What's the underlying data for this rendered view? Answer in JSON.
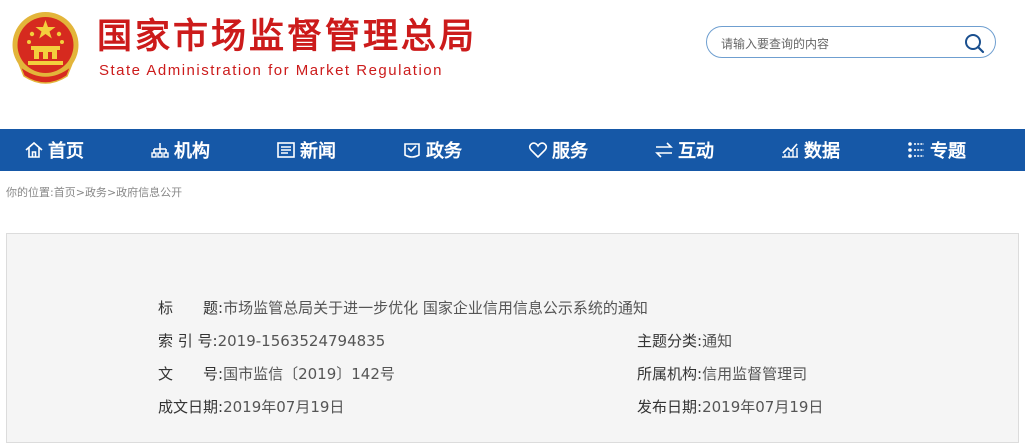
{
  "header": {
    "title_cn": "国家市场监督管理总局",
    "title_en": "State Administration for Market Regulation",
    "emblem_icon": "national-emblem-icon",
    "brand_color": "#cc1b1b"
  },
  "search": {
    "placeholder": "请输入要查询的内容",
    "icon": "search-icon"
  },
  "nav": {
    "bg_color": "#1658a7",
    "items": [
      {
        "label": "首页",
        "icon": "home-icon"
      },
      {
        "label": "机构",
        "icon": "org-chart-icon"
      },
      {
        "label": "新闻",
        "icon": "news-icon"
      },
      {
        "label": "政务",
        "icon": "affairs-icon"
      },
      {
        "label": "服务",
        "icon": "heart-icon"
      },
      {
        "label": "互动",
        "icon": "exchange-icon"
      },
      {
        "label": "数据",
        "icon": "chart-icon"
      },
      {
        "label": "专题",
        "icon": "topic-icon"
      }
    ]
  },
  "breadcrumb": {
    "prefix": "你的位置:",
    "items": [
      "首页",
      "政务",
      "政府信息公开"
    ],
    "separator": ">"
  },
  "meta": {
    "title_label": "标　　题:",
    "title_value": "市场监管总局关于进一步优化 国家企业信用信息公示系统的通知",
    "index_label": "索 引 号:",
    "index_value": "2019-1563524794835",
    "topic_label": "主题分类:",
    "topic_value": "通知",
    "doc_label": "文　　号:",
    "doc_value": "国市监信〔2019〕142号",
    "org_label": "所属机构:",
    "org_value": "信用监督管理司",
    "date_label": "成文日期:",
    "date_value": "2019年07月19日",
    "pub_label": "发布日期:",
    "pub_value": "2019年07月19日"
  }
}
